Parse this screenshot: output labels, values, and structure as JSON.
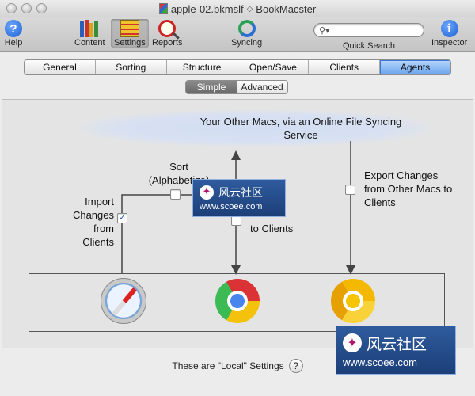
{
  "window": {
    "title": "apple-02.bkmslf",
    "app_name": "BookMacster"
  },
  "toolbar": {
    "help": "Help",
    "content": "Content",
    "settings": "Settings",
    "reports": "Reports",
    "syncing": "Syncing",
    "quick_search": "Quick Search",
    "inspector": "Inspector"
  },
  "tabs": [
    "General",
    "Sorting",
    "Structure",
    "Open/Save",
    "Clients",
    "Agents"
  ],
  "active_tab": "Agents",
  "subtabs": [
    "Simple",
    "Advanced"
  ],
  "active_subtab": "Simple",
  "diagram": {
    "cloud_text": "Your Other Macs, via an Online File Syncing Service",
    "sort_label": "Sort (Alphabetize)",
    "import_label": "Import Changes from Clients",
    "export_to_label": "to Clients",
    "export_other_label": "Export Changes from Other Macs to Clients",
    "import_checked": true,
    "sort_checked": false,
    "export_checked": false,
    "export_other_checked": false
  },
  "footer": {
    "text": "These are \"Local\" Settings"
  },
  "watermark": {
    "name": "风云社区",
    "url": "www.scoee.com"
  }
}
